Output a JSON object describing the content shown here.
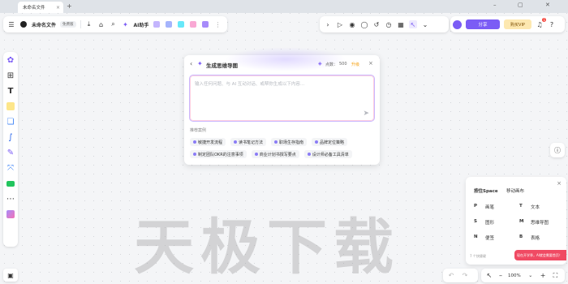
{
  "browser": {
    "tab_title": "未命名文件",
    "new_tab": "+",
    "min": "–",
    "restore": "▢",
    "close": "✕"
  },
  "header": {
    "menu_icon": "hamburger-icon",
    "file_name": "未命名文件",
    "plan_badge": "免费版",
    "ai_label": "AI助手"
  },
  "right_toolbar": {
    "share_label": "分享",
    "vip_label": "购买VIP",
    "notification_count": "1"
  },
  "dialog": {
    "title": "生成思维导图",
    "points_label": "点数：",
    "points_value": "500",
    "upgrade_label": "升级",
    "placeholder": "输入任何问题、与 AI 互动对话、或帮你生成以下内容…",
    "examples_label": "推荐案例",
    "examples": [
      [
        "敏捷开发流程",
        "读书笔记方法",
        "职场生存指南",
        "品牌定位策略"
      ],
      [
        "制定团队OKR的注意事项",
        "商业计划书撰写要点",
        "设计师必备工具清单"
      ]
    ]
  },
  "shortcuts": {
    "hold_label": "按住Space",
    "hold_action": "移动画布",
    "items": [
      {
        "key": "P",
        "label": "画笔"
      },
      {
        "key": "T",
        "label": "文本"
      },
      {
        "key": "S",
        "label": "图形"
      },
      {
        "key": "M",
        "label": "思维导图"
      },
      {
        "key": "N",
        "label": "便签"
      },
      {
        "key": "B",
        "label": "表格"
      }
    ],
    "footer": "7 个快捷键",
    "promo": "现在开学季，AI就会需要首页！"
  },
  "watermark": "天极下载",
  "zoom": {
    "value": "100%",
    "minus": "–",
    "plus": "+"
  },
  "colors": {
    "accent": "#7b5cf5",
    "vip_bg": "#fde8b0",
    "badge_red": "#f5433b",
    "promo_red": "#f04a63"
  }
}
